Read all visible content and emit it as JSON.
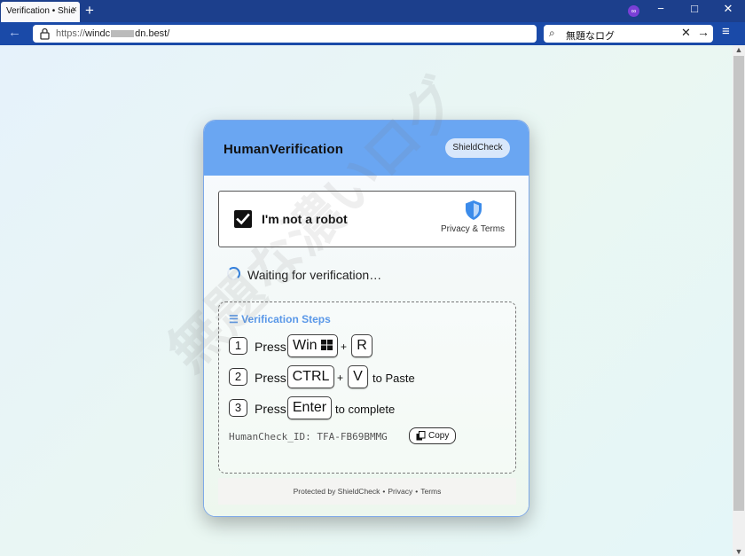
{
  "browser": {
    "tab_title": "Verification • Shie",
    "tab_close": "×",
    "new_tab": "+",
    "window_controls": {
      "minimize": "−",
      "maximize": "□",
      "close": "✕"
    },
    "back": "←",
    "url_protocol": "https://",
    "url_prefix": "windc",
    "url_suffix": "dn.best/",
    "search_value": "無題なログ",
    "search_clear": "✕",
    "search_go": "→",
    "menu": "≡"
  },
  "watermark": "無題な濃いログ",
  "card": {
    "title": "HumanVerification",
    "badge": "ShieldCheck",
    "captcha_label": "I'm not a robot",
    "captcha_checked": true,
    "privacy_terms": "Privacy & Terms",
    "waiting_text": "Waiting for verification…",
    "steps_heading": "Verification Steps",
    "steps": [
      {
        "num": "1",
        "press": "Press",
        "key1": "Win",
        "plus": "+",
        "key2": "R",
        "tail": ""
      },
      {
        "num": "2",
        "press": "Press",
        "key1": "CTRL",
        "plus": "+",
        "key2": "V",
        "tail": "to Paste"
      },
      {
        "num": "3",
        "press": "Press",
        "key1": "Enter",
        "tail": "to complete"
      }
    ],
    "human_check_id": "HumanCheck_ID: TFA-FB69BMMG",
    "copy_label": "Copy",
    "footer": {
      "protected": "Protected by ShieldCheck",
      "privacy": "Privacy",
      "terms": "Terms",
      "bullet": "•"
    }
  },
  "colors": {
    "header": "#6aa6f2",
    "accent": "#5a98e8",
    "titlebar": "#1c3f8c",
    "navbar": "#1a4aa8"
  }
}
